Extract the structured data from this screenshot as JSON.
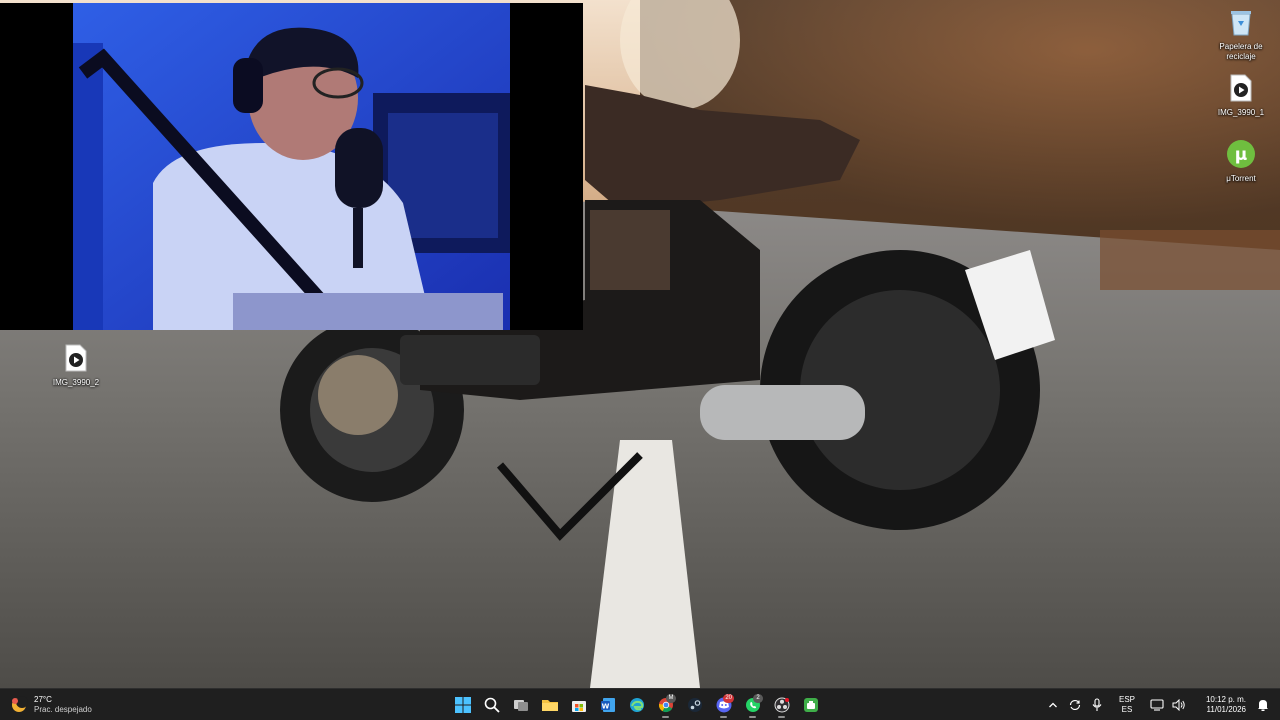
{
  "desktop": {
    "icons": [
      {
        "label": "Papelera de reciclaje",
        "icon": "recycle-bin-icon"
      },
      {
        "label": "IMG_3990_1",
        "icon": "video-file-icon"
      },
      {
        "label": "μTorrent",
        "icon": "utorrent-icon"
      },
      {
        "label": "IMG_3990_2",
        "icon": "video-file-icon"
      }
    ]
  },
  "taskbar": {
    "weather": {
      "temp": "27°C",
      "desc": "Prac. despejado"
    },
    "apps": [
      {
        "name": "start-button",
        "icon": "windows-icon",
        "active": false
      },
      {
        "name": "search-button",
        "icon": "search-icon",
        "active": false
      },
      {
        "name": "task-view-button",
        "icon": "task-view-icon",
        "active": false
      },
      {
        "name": "file-explorer-button",
        "icon": "folder-icon",
        "active": false
      },
      {
        "name": "microsoft-store-button",
        "icon": "store-icon",
        "active": false
      },
      {
        "name": "word-button",
        "icon": "word-icon",
        "active": false
      },
      {
        "name": "edge-button",
        "icon": "edge-icon",
        "active": false
      },
      {
        "name": "chrome-button",
        "icon": "chrome-icon",
        "active": true,
        "badge": "M"
      },
      {
        "name": "steam-button",
        "icon": "steam-icon",
        "active": false
      },
      {
        "name": "discord-button",
        "icon": "discord-icon",
        "active": true,
        "badge": "20"
      },
      {
        "name": "whatsapp-button",
        "icon": "whatsapp-icon",
        "active": true,
        "badge": "2"
      },
      {
        "name": "obs-button",
        "icon": "obs-icon",
        "active": true
      },
      {
        "name": "green-app-button",
        "icon": "app-icon",
        "active": false
      }
    ],
    "language": {
      "lang": "ESP",
      "region": "ES"
    },
    "clock": {
      "time": "10:12 p. m.",
      "date": "11/01/2026"
    }
  },
  "colors": {
    "taskbar": "#1f1f1f",
    "accent": "#0067c0"
  }
}
